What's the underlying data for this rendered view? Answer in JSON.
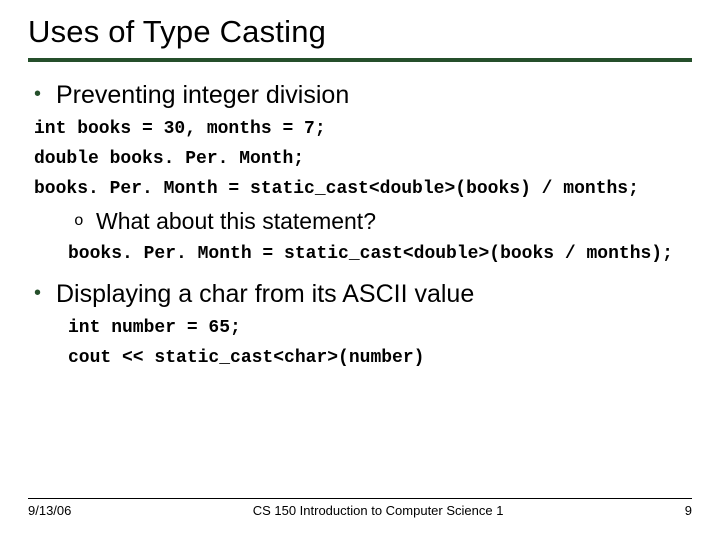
{
  "title": "Uses of Type Casting",
  "b1a": "Preventing integer division",
  "code1": "int books = 30, months = 7;",
  "code2": "double books. Per. Month;",
  "code3": "books. Per. Month = static_cast<double>(books) / months;",
  "b2a": "What about this statement?",
  "code4": "books. Per. Month = static_cast<double>(books / months);",
  "b1b": "Displaying a char from its ASCII value",
  "code5": "int number = 65;",
  "code6": "cout << static_cast<char>(number)",
  "footer": {
    "date": "9/13/06",
    "course": "CS 150 Introduction to Computer Science 1",
    "page": "9"
  }
}
